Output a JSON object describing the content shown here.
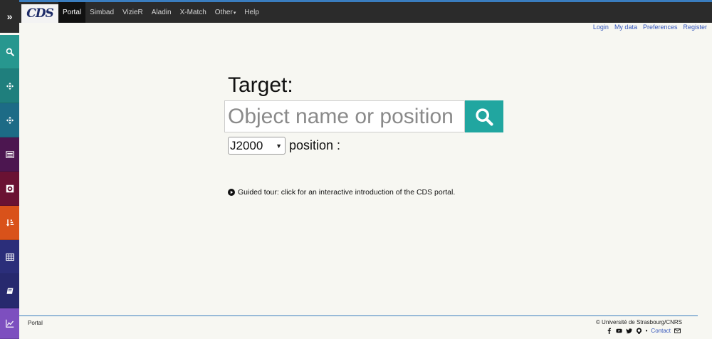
{
  "header": {
    "logo": "CDS",
    "nav": [
      {
        "label": "Portal"
      },
      {
        "label": "Simbad"
      },
      {
        "label": "VizieR"
      },
      {
        "label": "Aladin"
      },
      {
        "label": "X-Match"
      },
      {
        "label": "Other",
        "dropdown": true
      },
      {
        "label": "Help"
      }
    ],
    "user_links": [
      "Login",
      "My data",
      "Preferences",
      "Register"
    ],
    "accent_color": "#3a7dbf"
  },
  "sidebar": {
    "items": [
      {
        "name": "expand-toggle",
        "icon": "double-chevron-right-icon",
        "glyph": "»",
        "color": "#2b2b2b"
      },
      {
        "name": "search-tool",
        "icon": "search-icon",
        "color": "#27978f"
      },
      {
        "name": "cone-search-tool",
        "icon": "crosshair-icon",
        "color": "#1f7f7d"
      },
      {
        "name": "position-tool",
        "icon": "crosshair-icon",
        "color": "#1d6b86"
      },
      {
        "name": "catalogue-tool",
        "icon": "list-icon",
        "color": "#4c1650"
      },
      {
        "name": "image-tool",
        "icon": "image-icon",
        "color": "#6a1233"
      },
      {
        "name": "sort-tool",
        "icon": "sort-icon",
        "color": "#d9521a"
      },
      {
        "name": "table-tool",
        "icon": "table-icon",
        "color": "#2b2e7a"
      },
      {
        "name": "documentation-tool",
        "icon": "book-icon",
        "color": "#27296e"
      },
      {
        "name": "chart-tool",
        "icon": "chart-icon",
        "color": "#7d4fbf"
      }
    ]
  },
  "main": {
    "target_label": "Target:",
    "search_placeholder": "Object name or position",
    "search_button_color": "#21a6a0",
    "epoch_value": "J2000",
    "position_label": "position :",
    "tour_text": "Guided tour: click for an interactive introduction of the CDS portal."
  },
  "footer": {
    "left": "Portal",
    "copyright": "© Université de Strasbourg/CNRS",
    "social_icons": [
      "facebook-icon",
      "youtube-icon",
      "twitter-icon",
      "github-icon"
    ],
    "contact_label": "Contact"
  }
}
